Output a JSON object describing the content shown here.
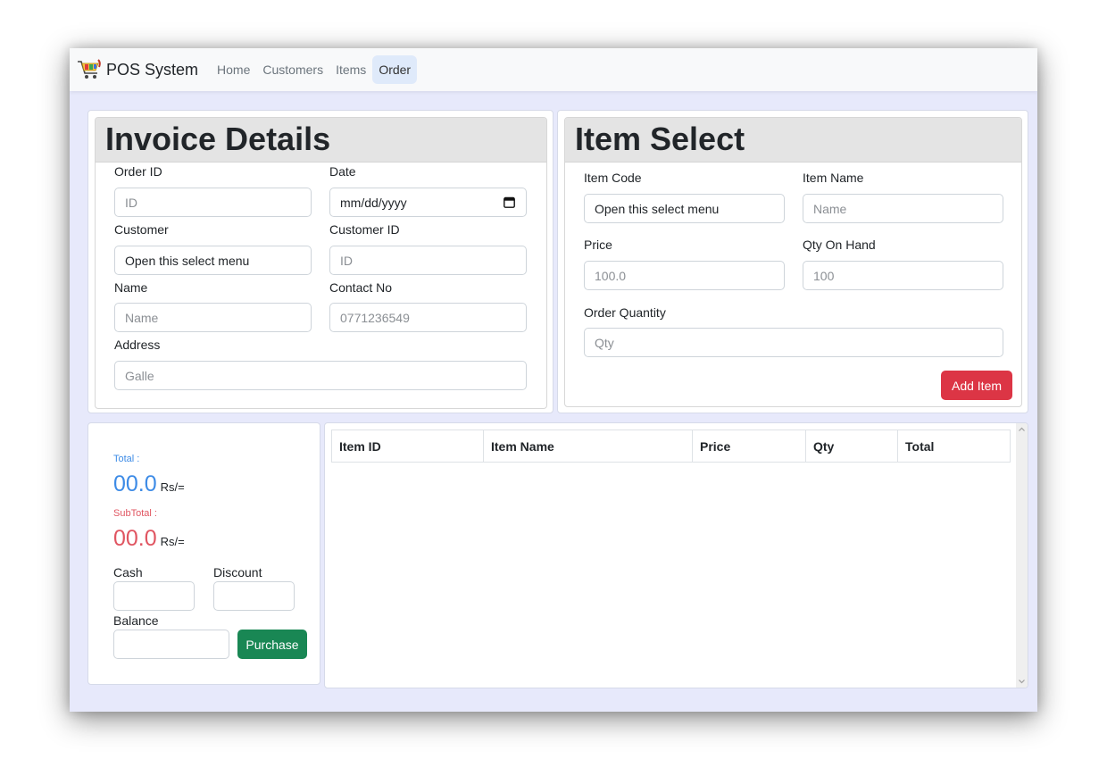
{
  "app": {
    "brand": "POS System",
    "nav": [
      "Home",
      "Customers",
      "Items",
      "Order"
    ],
    "active_nav": "Order"
  },
  "invoice": {
    "title": "Invoice Details",
    "order_id_label": "Order ID",
    "order_id_placeholder": "ID",
    "date_label": "Date",
    "date_placeholder": "mm/dd/yyyy",
    "customer_label": "Customer",
    "customer_value": "Open this select menu",
    "customer_id_label": "Customer ID",
    "customer_id_placeholder": "ID",
    "name_label": "Name",
    "name_placeholder": "Name",
    "contact_label": "Contact No",
    "contact_placeholder": "0771236549",
    "address_label": "Address",
    "address_placeholder": "Galle"
  },
  "item_select": {
    "title": "Item Select",
    "item_code_label": "Item Code",
    "item_code_value": "Open this select menu",
    "item_name_label": "Item Name",
    "item_name_placeholder": "Name",
    "price_label": "Price",
    "price_placeholder": "100.0",
    "qty_on_hand_label": "Qty On Hand",
    "qty_on_hand_placeholder": "100",
    "order_qty_label": "Order Quantity",
    "order_qty_placeholder": "Qty",
    "add_button": "Add Item"
  },
  "summary": {
    "total_label": "Total :",
    "total_value": "00.0",
    "total_unit": "Rs/=",
    "subtotal_label": "SubTotal :",
    "subtotal_value": "00.0",
    "subtotal_unit": "Rs/=",
    "cash_label": "Cash",
    "discount_label": "Discount",
    "balance_label": "Balance",
    "purchase_button": "Purchase",
    "colors": {
      "total": "#3d8be6",
      "subtotal": "#e05561"
    }
  },
  "cart_table": {
    "columns": [
      "Item ID",
      "Item Name",
      "Price",
      "Qty",
      "Total"
    ],
    "rows": []
  }
}
